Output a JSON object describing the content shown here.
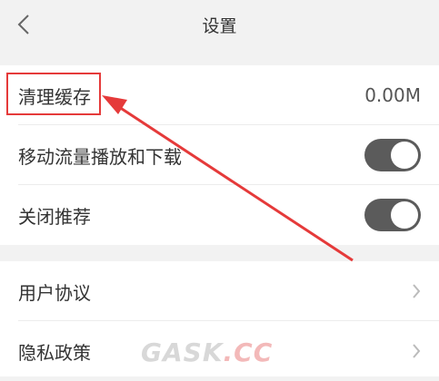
{
  "header": {
    "title": "设置",
    "back_icon": "chevron-left-icon"
  },
  "settings": {
    "clear_cache": {
      "label": "清理缓存",
      "value": "0.00M"
    },
    "mobile_data": {
      "label": "移动流量播放和下载",
      "enabled": true
    },
    "recommendations": {
      "label": "关闭推荐",
      "enabled": true
    }
  },
  "about": {
    "user_agreement": {
      "label": "用户协议",
      "icon": "chevron-right-icon"
    },
    "privacy_policy": {
      "label": "隐私政策",
      "icon": "chevron-right-icon"
    }
  },
  "annotation": {
    "color": "#e53a3a"
  },
  "watermark": {
    "part1": "GASK",
    "part2": ".CC"
  }
}
